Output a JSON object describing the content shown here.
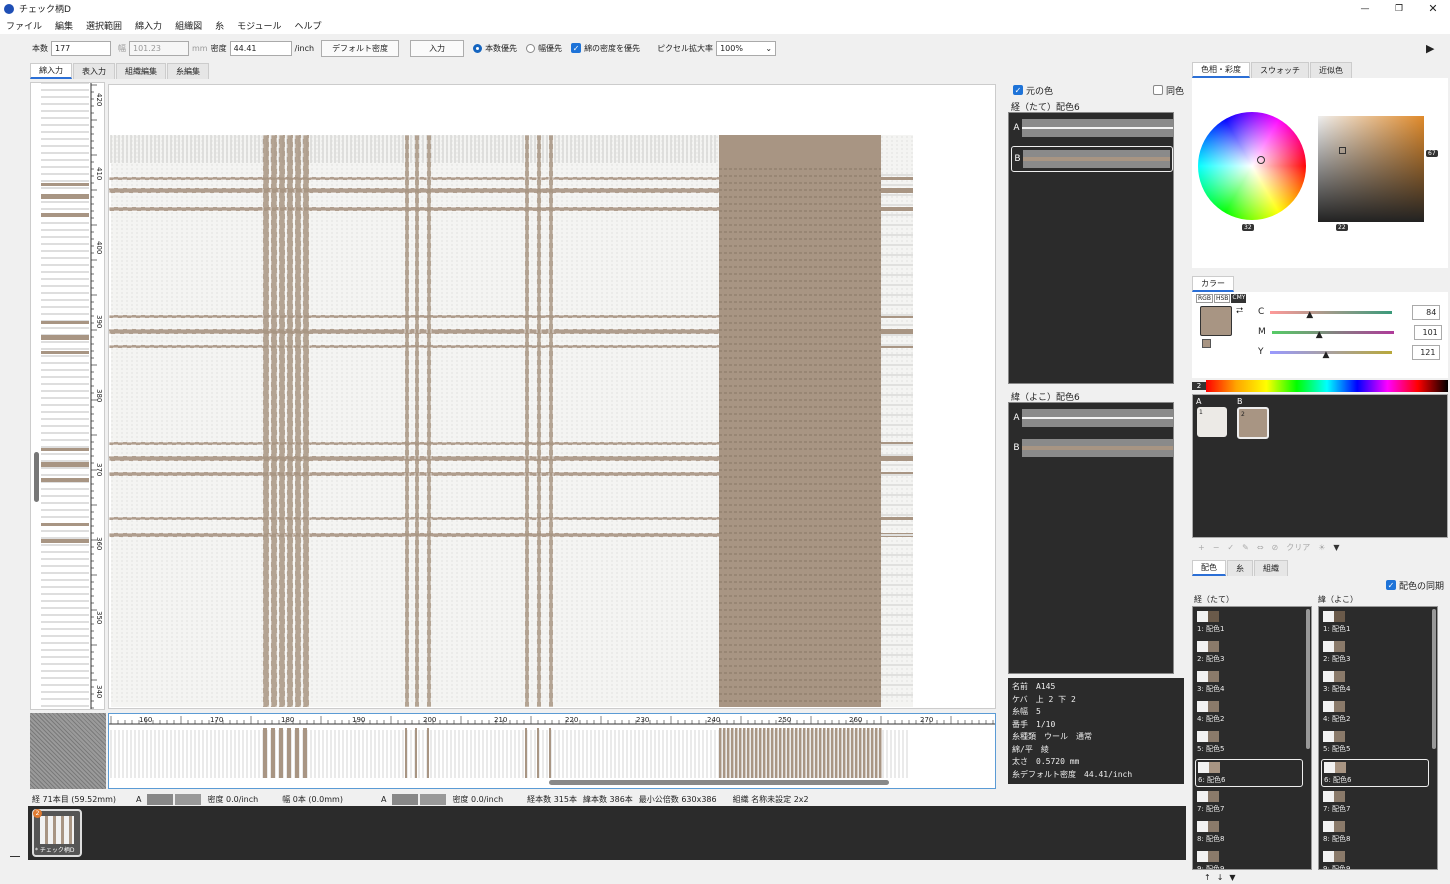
{
  "app": {
    "title": "チェック柄D"
  },
  "menu": [
    "ファイル",
    "編集",
    "選択範囲",
    "綿入力",
    "組織図",
    "糸",
    "モジュール",
    "ヘルプ"
  ],
  "toolbar": {
    "count_label": "本数",
    "count_value": "177",
    "width_label": "幅",
    "width_value": "101.23",
    "width_unit": "mm",
    "density_label": "密度",
    "density_value": "44.41",
    "density_unit": "/inch",
    "default_density_btn": "デフォルト密度",
    "input_btn": "入力",
    "radio_count": "本数優先",
    "radio_width": "幅優先",
    "check_density": "綿の密度を優先",
    "zoom_label": "ピクセル拡大率",
    "zoom_value": "100%"
  },
  "tabs": [
    "綿入力",
    "表入力",
    "組織編集",
    "糸編集"
  ],
  "ruler_left_labels": [
    "420",
    "410",
    "400",
    "390",
    "380",
    "370",
    "360",
    "350",
    "340"
  ],
  "ruler_bottom_labels": [
    "160",
    "170",
    "180",
    "190",
    "200",
    "210",
    "220",
    "230",
    "240",
    "250",
    "260",
    "270"
  ],
  "palette_panel": {
    "original_color": "元の色",
    "same_color": "同色",
    "warp_title": "経（たて）配色6",
    "weft_title": "緯（よこ）配色6",
    "rows": [
      "A",
      "B"
    ],
    "info": [
      "名前　A145",
      "ケバ　上 2 下 2",
      "糸幅　5",
      "番手　1/10",
      "糸種類　ウール　通常",
      "綿/平　綾",
      "太さ　0.5720 mm",
      "糸デフォルト密度　44.41/inch"
    ]
  },
  "status": {
    "warp_pos": "経 71本目 (59.52mm)",
    "warp_A": "A",
    "warp_density": "密度 0.0/inch",
    "weft_pos": "幅 0本 (0.0mm)",
    "weft_A": "A",
    "weft_density": "密度 0.0/inch",
    "warp_count": "経本数 315本",
    "weft_count": "緯本数 386本",
    "lcm": "最小公倍数 630x386",
    "weave": "組織 名称未設定 2x2"
  },
  "thumb": {
    "label": "* チェック柄D",
    "badge": "2"
  },
  "right": {
    "tabs_top": [
      "色相・彩度",
      "スウォッチ",
      "近似色"
    ],
    "hue_label": "32",
    "sat_label": "22",
    "val_label": "67",
    "color_tab": "カラー",
    "modes": [
      "RGB",
      "HSB",
      "CMY"
    ],
    "sliders": [
      {
        "label": "C",
        "value": "84"
      },
      {
        "label": "M",
        "value": "101"
      },
      {
        "label": "Y",
        "value": "121"
      }
    ],
    "spectrum_idx": "2",
    "swatch_cols": [
      "A",
      "B"
    ],
    "swatch_nums": [
      "1",
      "2"
    ],
    "clear_label": "クリア",
    "tabs_bottom": [
      "配色",
      "糸",
      "組織"
    ],
    "sync_label": "配色の同期",
    "warp_list_title": "経（たて）",
    "weft_list_title": "緯（よこ）",
    "list_items": [
      "1: 配色1",
      "2: 配色3",
      "3: 配色4",
      "4: 配色2",
      "5: 配色5",
      "6: 配色6",
      "7: 配色7",
      "8: 配色8",
      "9: 配色9"
    ]
  },
  "colors": {
    "accent": "#2b6fd6",
    "beige": "#a89583",
    "dark": "#2b2b2b"
  }
}
